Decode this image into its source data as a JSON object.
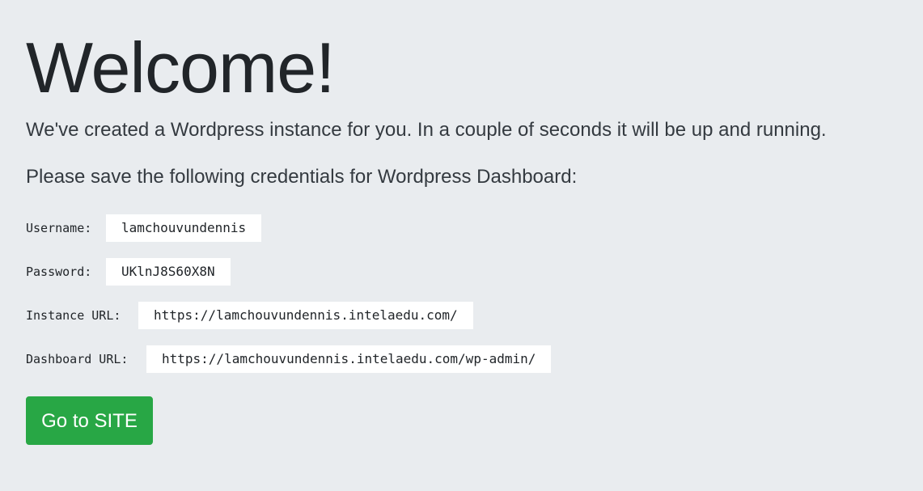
{
  "header": {
    "title": "Welcome!"
  },
  "intro": {
    "line1": "We've created a Wordpress instance for you. In a couple of seconds it will be up and running.",
    "line2": "Please save the following credentials for Wordpress Dashboard:"
  },
  "credentials": [
    {
      "label": "Username:",
      "value": "lamchouvundennis"
    },
    {
      "label": "Password:",
      "value": "UKlnJ8S60X8N"
    },
    {
      "label": "Instance URL:",
      "value": "https://lamchouvundennis.intelaedu.com/"
    },
    {
      "label": "Dashboard URL:",
      "value": "https://lamchouvundennis.intelaedu.com/wp-admin/"
    }
  ],
  "actions": {
    "go_to_site_label": "Go to SITE"
  },
  "colors": {
    "background": "#e9ecef",
    "button": "#28a745",
    "value_box": "#ffffff"
  }
}
